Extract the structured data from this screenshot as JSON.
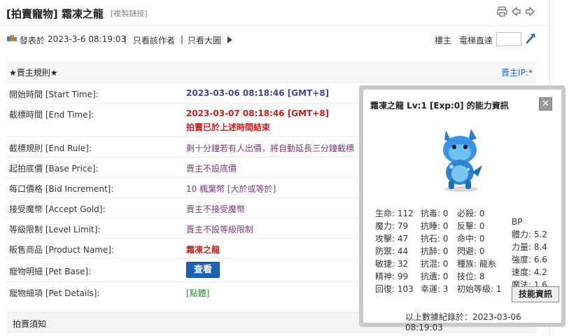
{
  "title": {
    "main": "[拍賣寵物] 霜凍之龍",
    "copy_link": "[複製鏈接]"
  },
  "meta": {
    "posted_label": "發表於",
    "posted_time": "2023-3-6 08:19:03",
    "author_only": "只看該作者",
    "big_image": "只看大圖",
    "floor_owner": "樓主",
    "elevator": "電梯直達"
  },
  "rules": {
    "header": "★賣主規則★",
    "seller_ip": "賣主IP:*",
    "rows": [
      {
        "label": "開始時間 [Start Time]:",
        "value": "2023-03-06 08:18:46 [GMT+8]"
      },
      {
        "label": "截標時間 [End Time]:",
        "value": "2023-03-07 08:18:46 [GMT+8]",
        "note": "拍賣已於上述時間結束"
      },
      {
        "label": "截標規則 [End Rule]:",
        "value": "剩十分鐘若有人出價，將自動延長三分鐘截標"
      },
      {
        "label": "起拍底價 [Base Price]:",
        "value": "賣主不設底價"
      },
      {
        "label": "每口價格 [Bid Increment]:",
        "value": "10 楓葉幣 [大於或等於]"
      },
      {
        "label": "接受魔幣 [Accept Gold]:",
        "value": "賣主不接受魔幣"
      },
      {
        "label": "等級限制 [Level Limit]:",
        "value": "賣主不設等級限制"
      },
      {
        "label": "販售商品 [Product Name]:",
        "value": "霜凍之龍"
      },
      {
        "label": "寵物明細 [Pet Base]:",
        "value": "查看"
      },
      {
        "label": "寵物細項 [Pet Details]:",
        "value": "[點體]"
      }
    ]
  },
  "notice": "拍賣須知",
  "popup": {
    "title": "霜凍之龍 Lv:1 [Exp:0] 的能力資訊",
    "close": "✕",
    "col1": [
      "生命: 112",
      "魔力: 79",
      "攻擊: 47",
      "防禦: 44",
      "敏捷: 32",
      "精神: 99",
      "回復: 103"
    ],
    "col2": [
      "抗毒: 0",
      "抗睡: 0",
      "抗石: 0",
      "抗醉: 0",
      "抗混: 0",
      "抗遺: 0",
      "幸運: 3"
    ],
    "col3": [
      "必殺: 0",
      "反擊: 0",
      "命中: 0",
      "閃避: 0",
      "種族: 龍糸",
      "技位: 8",
      "初始等級: 1"
    ],
    "bp_label": "BP",
    "bp": [
      "體力: 5.2",
      "力量: 8.4",
      "強度: 6.6",
      "速度: 4.2",
      "魔法: 1.6"
    ],
    "skill_button": "技能資訊",
    "footer": "以上數據紀錄於：2023-03-06 08:19:03"
  },
  "colors": {
    "accent_blue": "#1c63b8",
    "start_time": "#3a4c8c",
    "end_time": "#c81e1e",
    "value_purple": "#7a3a7a",
    "details_green": "#2a8a2a"
  }
}
